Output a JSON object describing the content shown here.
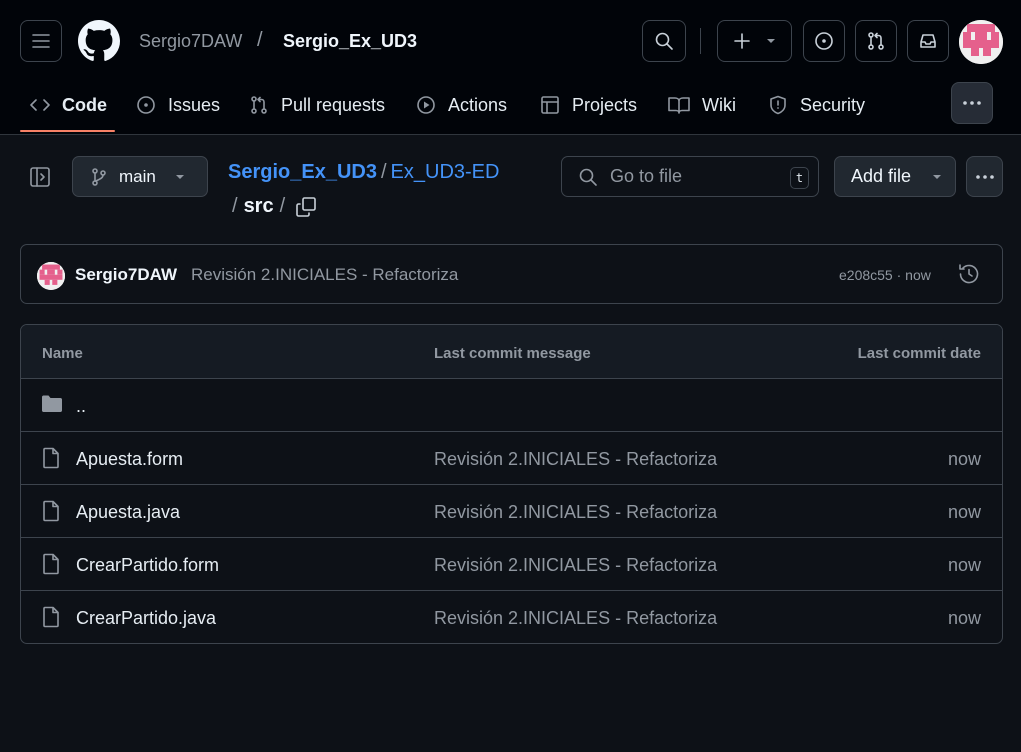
{
  "header": {
    "owner": "Sergio7DAW",
    "separator": "/",
    "repo": "Sergio_Ex_UD3"
  },
  "tabs": [
    {
      "label": "Code",
      "icon": "code-icon",
      "active": true
    },
    {
      "label": "Issues",
      "icon": "issue-icon"
    },
    {
      "label": "Pull requests",
      "icon": "pull-request-icon"
    },
    {
      "label": "Actions",
      "icon": "play-icon"
    },
    {
      "label": "Projects",
      "icon": "table-icon"
    },
    {
      "label": "Wiki",
      "icon": "book-icon"
    },
    {
      "label": "Security",
      "icon": "shield-icon"
    }
  ],
  "repo_bar": {
    "branch": "main",
    "path_repo": "Sergio_Ex_UD3",
    "path_sep": "/",
    "path_folder": "Ex_UD3-ED",
    "path_current": "src",
    "goto_placeholder": "Go to file",
    "goto_shortcut": "t",
    "add_file": "Add file"
  },
  "commit": {
    "author": "Sergio7DAW",
    "message": "Revisión 2.INICIALES - Refactoriza",
    "sha_time": "e208c55 · now"
  },
  "table": {
    "col_name": "Name",
    "col_message": "Last commit message",
    "col_date": "Last commit date",
    "parent": "..",
    "files": [
      {
        "name": "Apuesta.form",
        "message": "Revisión 2.INICIALES - Refactoriza",
        "date": "now"
      },
      {
        "name": "Apuesta.java",
        "message": "Revisión 2.INICIALES - Refactoriza",
        "date": "now"
      },
      {
        "name": "CrearPartido.form",
        "message": "Revisión 2.INICIALES - Refactoriza",
        "date": "now"
      },
      {
        "name": "CrearPartido.java",
        "message": "Revisión 2.INICIALES - Refactoriza",
        "date": "now"
      }
    ]
  },
  "colors": {
    "background": "#0d1117",
    "header_bg": "#010409",
    "link": "#4493f8",
    "active_tab_underline": "#f78166",
    "avatar_accent": "#e5608c"
  }
}
